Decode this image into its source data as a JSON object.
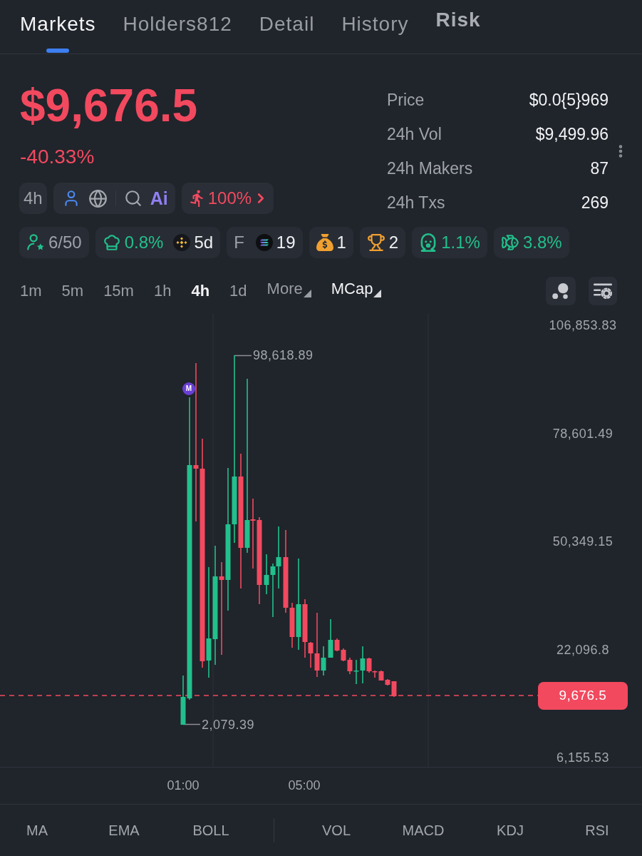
{
  "tabs": [
    {
      "label": "Markets",
      "selected": true,
      "emphasized": false
    },
    {
      "label": "Holders812",
      "selected": false,
      "emphasized": false
    },
    {
      "label": "Detail",
      "selected": false,
      "emphasized": false
    },
    {
      "label": "History",
      "selected": false,
      "emphasized": false
    },
    {
      "label": "Risk",
      "selected": false,
      "emphasized": true
    }
  ],
  "summary": {
    "market_cap": "$9,676.5",
    "change": "-40.33%",
    "interval": "4h",
    "ai_label": "Ai",
    "progress": "100%"
  },
  "stats": [
    {
      "label": "Price",
      "value": "$0.0{5}969"
    },
    {
      "label": "24h Vol",
      "value": "$9,499.96"
    },
    {
      "label": "24h Makers",
      "value": "87"
    },
    {
      "label": "24h Txs",
      "value": "269"
    }
  ],
  "badges": [
    {
      "kind": "holders",
      "value": "6/50"
    },
    {
      "kind": "dev",
      "value": "0.8%",
      "extra": "5d"
    },
    {
      "kind": "chain",
      "label": "F",
      "value": "19"
    },
    {
      "kind": "bag",
      "value": "1"
    },
    {
      "kind": "trophy",
      "value": "2"
    },
    {
      "kind": "mask",
      "value": "1.1%"
    },
    {
      "kind": "fish",
      "value": "3.8%"
    }
  ],
  "chart_toolbar": {
    "timeframes": [
      {
        "label": "1m",
        "selected": false
      },
      {
        "label": "5m",
        "selected": false
      },
      {
        "label": "15m",
        "selected": false
      },
      {
        "label": "1h",
        "selected": false
      },
      {
        "label": "4h",
        "selected": true
      },
      {
        "label": "1d",
        "selected": false
      }
    ],
    "dropdowns": [
      {
        "label": "More",
        "selected": false
      },
      {
        "label": "MCap",
        "selected": true
      }
    ]
  },
  "chart": {
    "y_axis_labels": [
      "106,853.83",
      "78,601.49",
      "50,349.15",
      "22,096.8",
      "6,155.53"
    ],
    "high_label": "98,618.89",
    "low_label": "2,079.39",
    "marker": "M",
    "last_price": "9,676.5",
    "x_axis_labels": [
      "01:00",
      "05:00"
    ]
  },
  "indicators": {
    "main": [
      "MA",
      "EMA",
      "BOLL"
    ],
    "sub": [
      "VOL",
      "MACD",
      "KDJ",
      "RSI"
    ]
  }
}
